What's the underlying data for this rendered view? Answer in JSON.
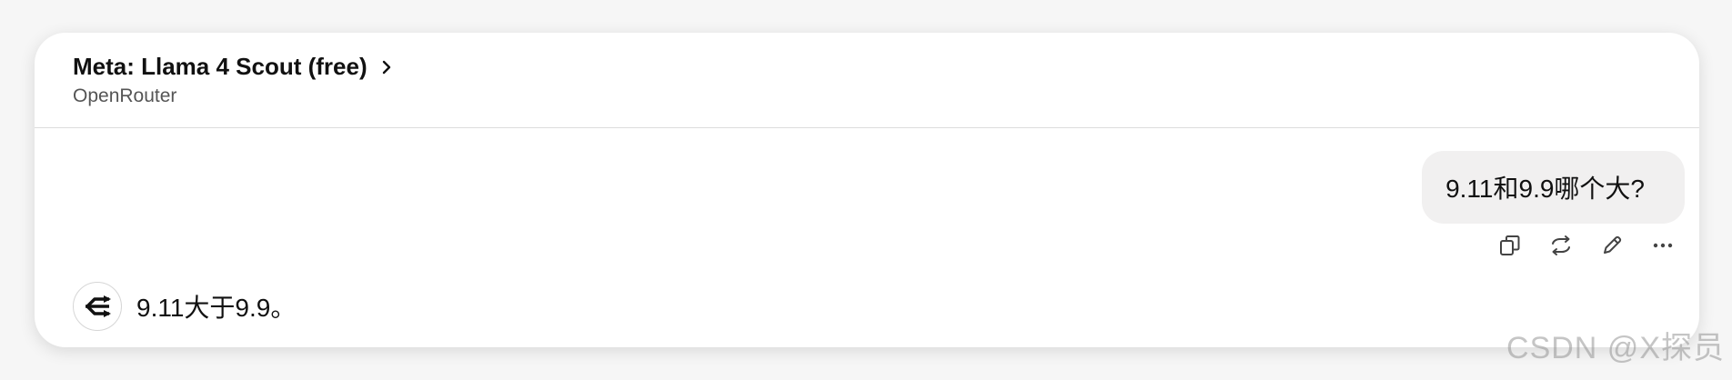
{
  "header": {
    "model_title": "Meta: Llama 4 Scout (free)",
    "provider": "OpenRouter",
    "chevron_icon": "chevron-right-icon"
  },
  "conversation": {
    "user_message": "9.11和9.9哪个大?",
    "assistant_message": "9.11大于9.9。",
    "assistant_avatar_icon": "openrouter-logo-icon"
  },
  "message_actions": [
    {
      "name": "copy",
      "icon": "copy-icon"
    },
    {
      "name": "regenerate",
      "icon": "regenerate-icon"
    },
    {
      "name": "edit",
      "icon": "edit-pencil-icon"
    },
    {
      "name": "more",
      "icon": "more-horizontal-icon"
    }
  ],
  "watermark": "CSDN @X探员",
  "colors": {
    "user_bubble": "#f1f0f0",
    "divider": "#dcdcdc",
    "text": "#111111",
    "secondary_text": "#555555"
  }
}
